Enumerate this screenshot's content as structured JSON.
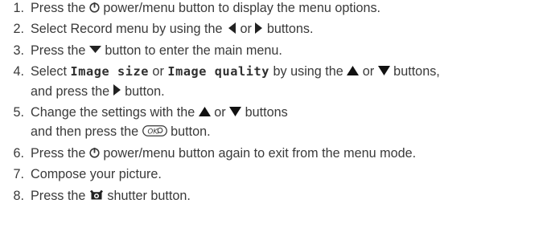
{
  "steps": [
    {
      "n": "1.",
      "a": "Press the ",
      "b": " power/menu button to display the menu options."
    },
    {
      "n": "2.",
      "a": "Select Record menu by using the ",
      "b": " or ",
      "c": " buttons."
    },
    {
      "n": "3.",
      "a": "Press the ",
      "b": " button to enter the main menu."
    },
    {
      "n": "4.",
      "a": "Select ",
      "m1": "Image size",
      "b": " or ",
      "m2": "Image quality",
      "c": " by using the ",
      "d": " or ",
      "e": " buttons,",
      "cont": "and press the ",
      "f": " button."
    },
    {
      "n": "5.",
      "a": "Change the settings with the ",
      "b": " or ",
      "c": " buttons",
      "cont": "and then press the ",
      "d": " button."
    },
    {
      "n": "6.",
      "a": "Press the ",
      "b": " power/menu button again to exit from the menu mode."
    },
    {
      "n": "7.",
      "a": "Compose your picture."
    },
    {
      "n": "8.",
      "a": "Press the ",
      "b": " shutter button."
    }
  ],
  "icons": {
    "power": "power-icon",
    "left": "left-arrow-icon",
    "right": "right-arrow-icon",
    "down": "down-arrow-icon",
    "up": "up-arrow-icon",
    "ok": "ok-button-icon",
    "shutter": "shutter-icon"
  }
}
